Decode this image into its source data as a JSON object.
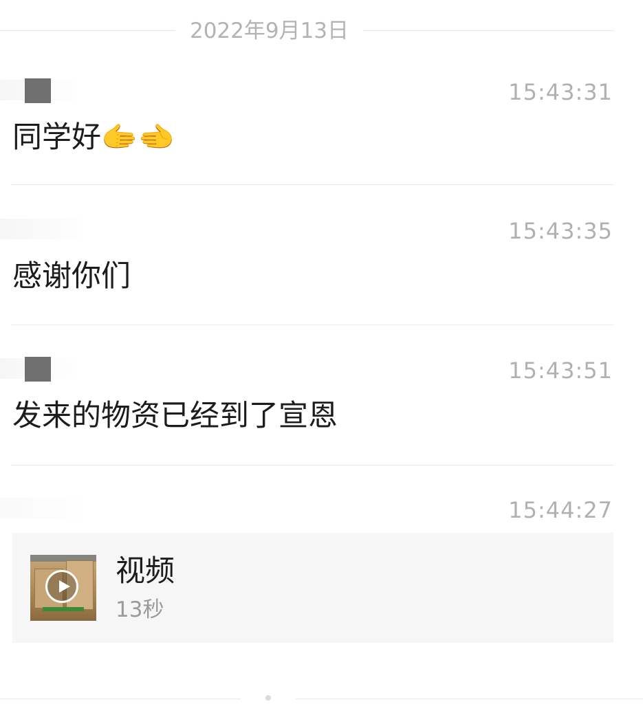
{
  "date_header": "2022年9月13日",
  "messages": [
    {
      "time": "15:43:31",
      "text": "同学好🫱🫲",
      "sender_visible": true
    },
    {
      "time": "15:43:35",
      "text": "感谢你们",
      "sender_visible": false
    },
    {
      "time": "15:43:51",
      "text": "发来的物资已经到了宣恩",
      "sender_visible": true
    },
    {
      "time": "15:44:27",
      "sender_visible": false,
      "video": {
        "title": "视频",
        "duration": "13秒",
        "icon": "play-icon"
      }
    }
  ]
}
